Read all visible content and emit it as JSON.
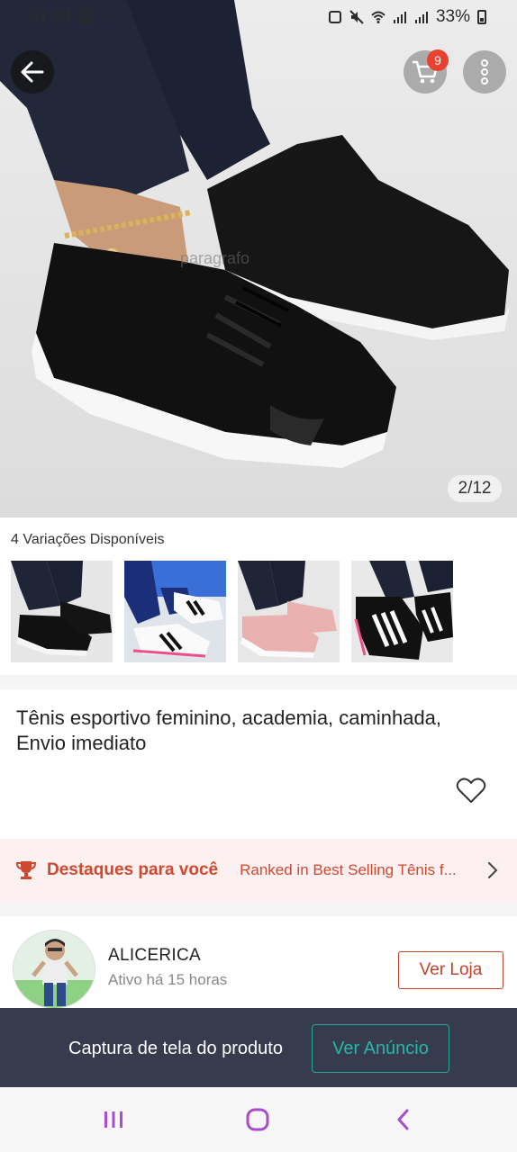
{
  "status_bar": {
    "time": "01:54",
    "battery": "33%"
  },
  "hero": {
    "cart_count": "9",
    "watermark": "paragrafo",
    "image_counter": "2/12",
    "current_image": 2,
    "total_images": 12
  },
  "variations": {
    "title": "4 Variações Disponíveis",
    "items": [
      {
        "icon": "black-sneaker-thumbnail"
      },
      {
        "icon": "white-sneaker-thumbnail"
      },
      {
        "icon": "pink-sneaker-thumbnail"
      },
      {
        "icon": "black-white-stripe-sneaker-thumbnail"
      }
    ]
  },
  "product": {
    "title": "Tênis esportivo feminino, academia, caminhada, Envio imediato"
  },
  "highlights": {
    "label": "Destaques para você",
    "text": "Ranked in Best Selling Tênis f...",
    "accent": "#d0482e"
  },
  "store": {
    "name": "ALICERICA",
    "status": "Ativo há 15 horas",
    "button": "Ver Loja"
  },
  "capture_bar": {
    "text": "Captura de tela do produto",
    "button": "Ver Anúncio"
  },
  "nav": {
    "recents_icon": "recents-icon",
    "home_icon": "home-icon",
    "back_icon": "back-icon",
    "accent": "#a94cc9"
  }
}
